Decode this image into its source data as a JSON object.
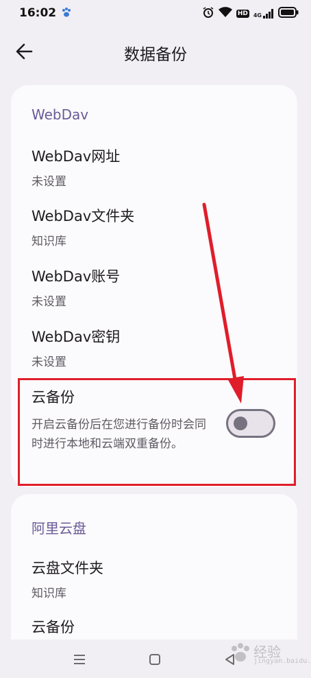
{
  "status_bar": {
    "time": "16:02",
    "icons": [
      "alarm-icon",
      "wifi-icon",
      "hd-icon",
      "signal-4g-icon",
      "battery-icon"
    ],
    "hd_label": "HD",
    "network_label": "4G"
  },
  "header": {
    "title": "数据备份",
    "back_icon": "back-arrow-icon"
  },
  "webdav": {
    "section_title": "WebDav",
    "items": [
      {
        "title": "WebDav网址",
        "value": "未设置"
      },
      {
        "title": "WebDav文件夹",
        "value": "知识库"
      },
      {
        "title": "WebDav账号",
        "value": "未设置"
      },
      {
        "title": "WebDav密钥",
        "value": "未设置"
      }
    ],
    "cloud_backup": {
      "title": "云备份",
      "description": "开启云备份后在您进行备份时会同时进行本地和云端双重备份。",
      "enabled": false
    }
  },
  "aliyun": {
    "section_title": "阿里云盘",
    "items": [
      {
        "title": "云盘文件夹",
        "value": "知识库"
      },
      {
        "title": "云备份",
        "value": ""
      }
    ]
  },
  "annotation": {
    "highlight_color": "#e01d2a"
  },
  "nav_bar": {
    "buttons": [
      "menu-icon",
      "home-icon",
      "back-icon"
    ]
  },
  "watermark": {
    "text": "经验",
    "sub": "jingyan.baidu.com"
  },
  "colors": {
    "accent": "#6a5a96",
    "background": "#f1eff4",
    "card": "#fbfafc"
  }
}
